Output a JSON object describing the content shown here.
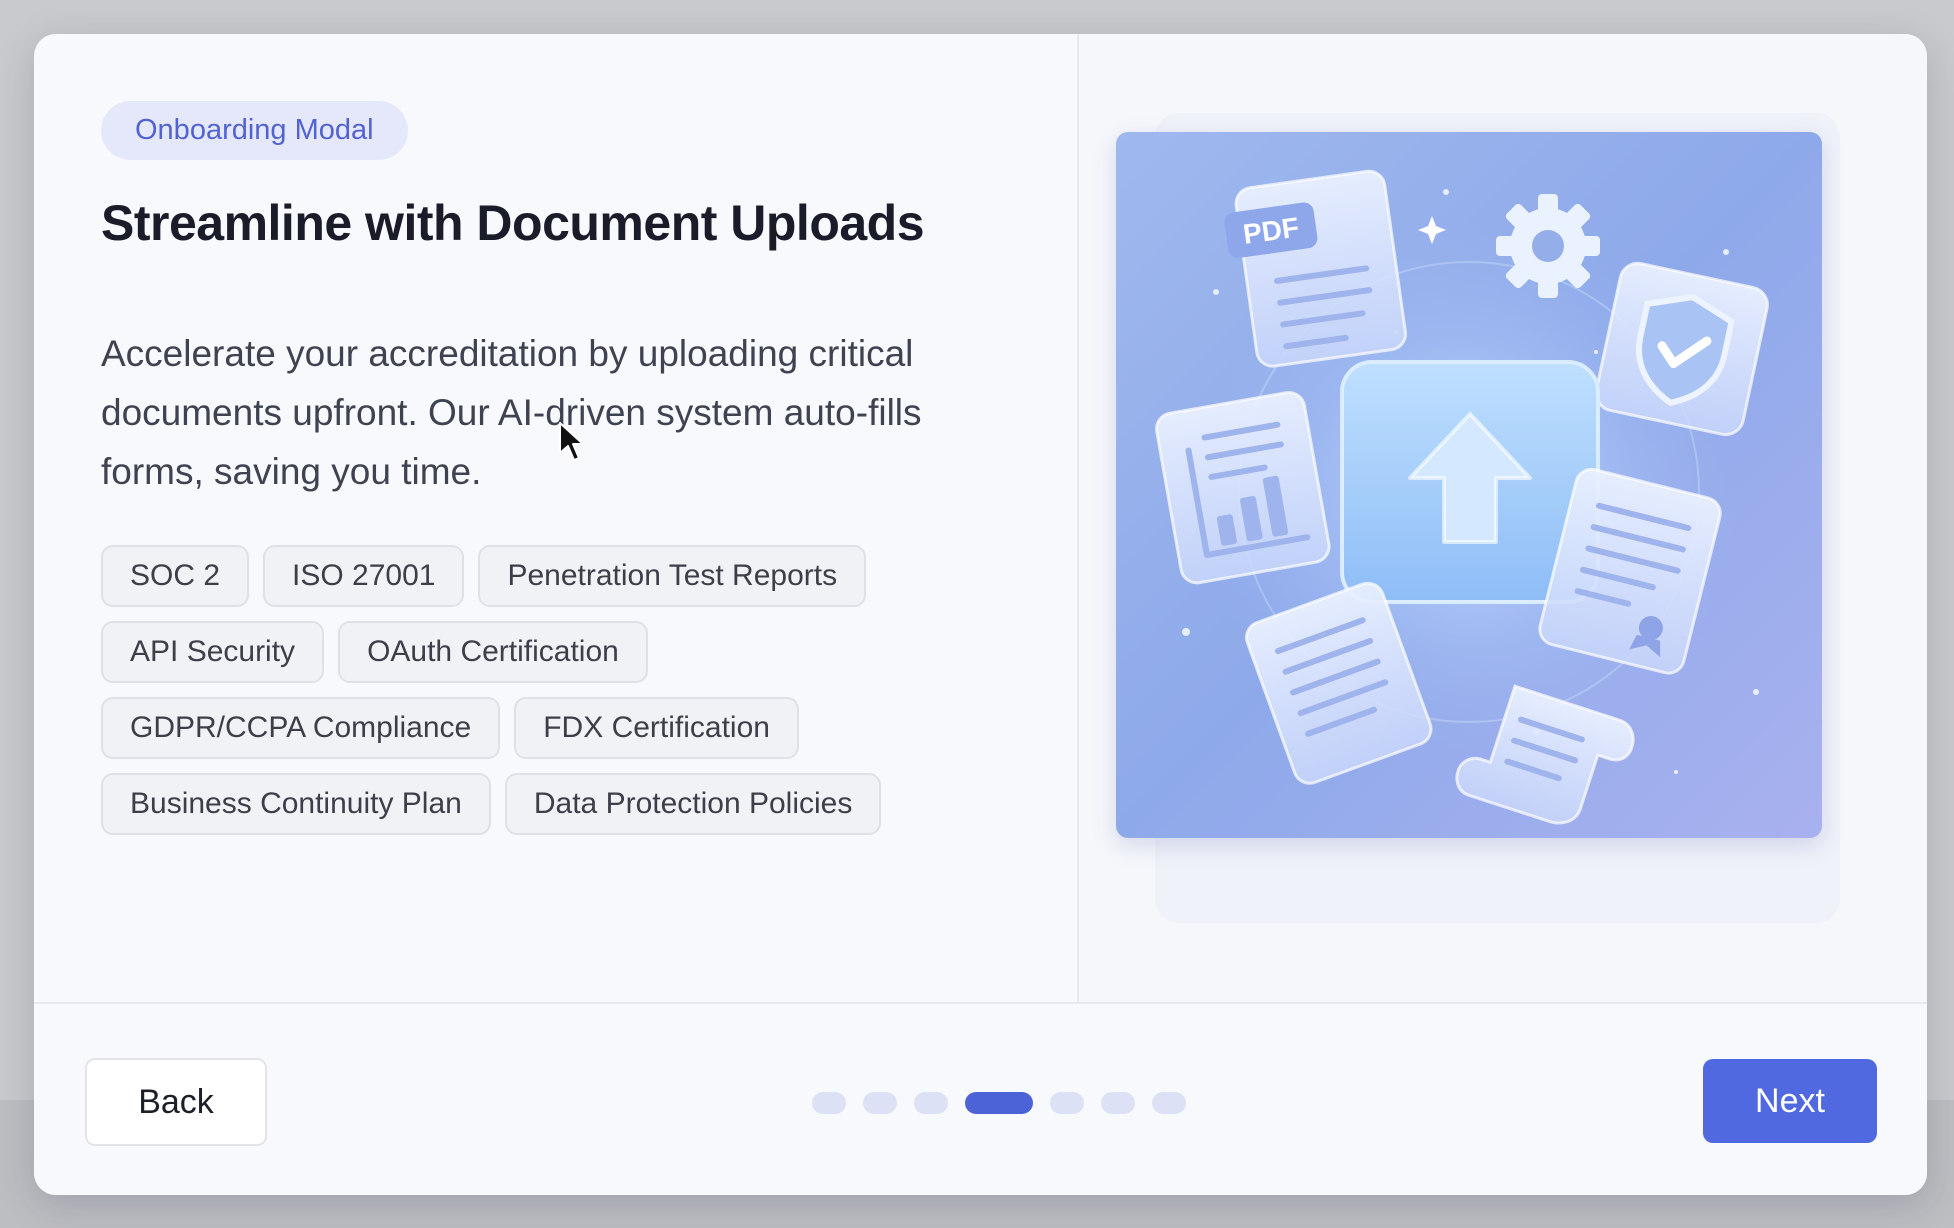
{
  "badge": "Onboarding Modal",
  "title": "Streamline with Document Uploads",
  "description": "Accelerate your accreditation by uploading critical documents upfront. Our AI-driven system auto-fills forms, saving you time.",
  "tags": [
    [
      "SOC 2",
      "ISO 27001",
      "Penetration Test Reports"
    ],
    [
      "API Security",
      "OAuth Certification"
    ],
    [
      "GDPR/CCPA Compliance",
      "FDX Certification"
    ],
    [
      "Business Continuity Plan",
      "Data Protection Policies"
    ]
  ],
  "illustration": {
    "pdf_label": "PDF",
    "icons": [
      "pdf-document-icon",
      "gear-icon",
      "shield-check-icon",
      "chart-document-icon",
      "upload-arrow-icon",
      "text-document-icon",
      "certificate-document-icon",
      "scroll-document-icon"
    ]
  },
  "footer": {
    "back_label": "Back",
    "next_label": "Next",
    "steps_total": 7,
    "current_step": 4
  },
  "colors": {
    "accent": "#5069e0",
    "badge_bg": "#e5e8fb",
    "badge_text": "#5263d1",
    "dot_inactive": "#dde1f6"
  }
}
